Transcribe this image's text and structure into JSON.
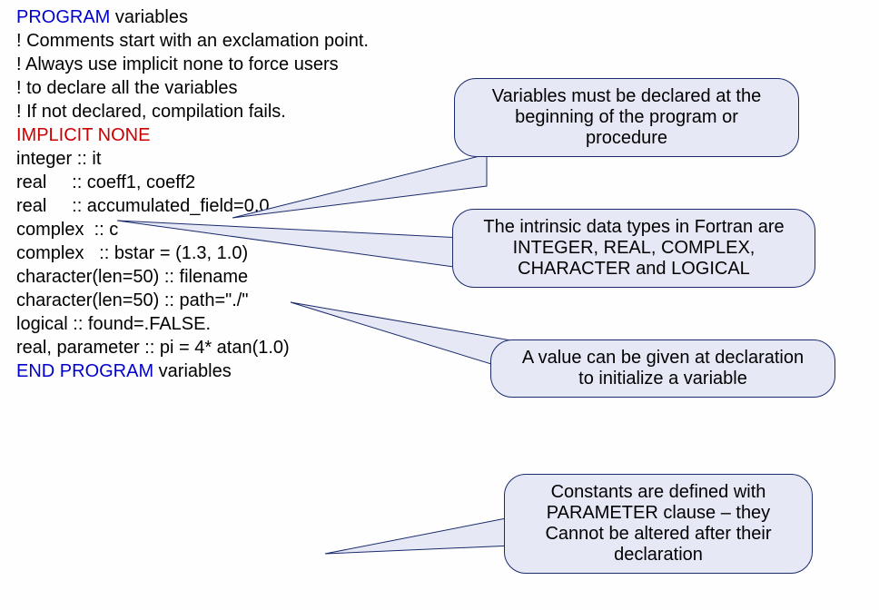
{
  "code": {
    "l01a": "PROGRAM",
    "l01b": " variables",
    "l02": "! Comments start with an exclamation point.",
    "l03": "",
    "l04": "! Always use implicit none to force users",
    "l05": "! to declare all the variables",
    "l06": "! If not declared, compilation fails.",
    "l07": "IMPLICIT NONE",
    "l08": "",
    "l09": "integer :: it",
    "l10": "",
    "l11": "real     :: coeff1, coeff2",
    "l12": "real     :: accumulated_field=0.0",
    "l13": "",
    "l14": "complex  :: c",
    "l15": "complex   :: bstar = (1.3, 1.0)",
    "l16": "",
    "l17": "character(len=50) :: filename",
    "l18": "character(len=50) :: path=\"./\"",
    "l19": "",
    "l20": "logical :: found=.FALSE.",
    "l21": "",
    "l22": "real, parameter :: pi = 4* atan(1.0)",
    "l23a": "END PROGRAM",
    "l23b": " variables"
  },
  "callouts": {
    "c1_l1": "Variables must be declared at the",
    "c1_l2": "beginning of the program or",
    "c1_l3": "procedure",
    "c2_l1": "The intrinsic data types in Fortran are",
    "c2_l2": "INTEGER, REAL, COMPLEX,",
    "c2_l3": "CHARACTER and LOGICAL",
    "c3_l1": "A value can be given at declaration",
    "c3_l2": "to initialize a variable",
    "c4_l1": "Constants are defined with",
    "c4_l2": "PARAMETER clause – they",
    "c4_l3": "Cannot be altered after their",
    "c4_l4": "declaration"
  }
}
